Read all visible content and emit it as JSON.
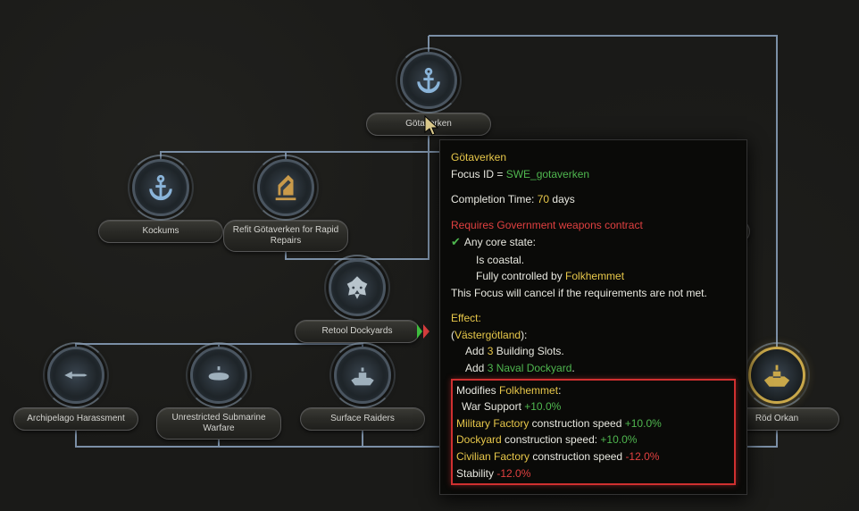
{
  "focus_nodes": {
    "gotaverken": {
      "label": "Götaverken"
    },
    "kockums": {
      "label": "Kockums"
    },
    "refit": {
      "label": "Refit Götaverken for Rapid Repairs"
    },
    "retool": {
      "label": "Retool Dockyards"
    },
    "archipelago": {
      "label": "Archipelago Harassment"
    },
    "submarine": {
      "label": "Unrestricted Submarine Warfare"
    },
    "surface": {
      "label": "Surface Raiders"
    },
    "rod_orkan": {
      "label": "Röd Orkan"
    },
    "hidden_right": {
      "label": "n"
    }
  },
  "tooltip": {
    "title": "Götaverken",
    "focus_id_label": "Focus ID = ",
    "focus_id": "SWE_gotaverken",
    "completion_label": "Completion Time: ",
    "completion_value": "70",
    "completion_suffix": " days",
    "requires": "Requires Government weapons contract",
    "req_line1": "Any core state:",
    "req_line2": "Is coastal.",
    "req_line3_prefix": "Fully controlled by ",
    "req_line3_faction": "Folkhemmet",
    "cancel_text": "This Focus will cancel if the requirements are not met.",
    "effect_label": "Effect:",
    "state_prefix": "(",
    "state_name": "Västergötland",
    "state_suffix": "):",
    "eff1_prefix": "Add ",
    "eff1_value": "3",
    "eff1_suffix": " Building Slots.",
    "eff2_prefix": "Add ",
    "eff2_value": "3 Naval Dockyard",
    "eff2_suffix": ".",
    "mod_label": "Modifies ",
    "mod_target": "Folkhemmet",
    "mod_suffix": ":",
    "ws_label": "War Support ",
    "ws_value": "+10.0%",
    "mf_label": "Military Factory",
    "mf_mid": " construction speed ",
    "mf_value": "+10.0%",
    "dy_label": "Dockyard",
    "dy_mid": " construction speed: ",
    "dy_value": "+10.0%",
    "cf_label": "Civilian Factory",
    "cf_mid": " construction speed ",
    "cf_value": "-12.0%",
    "st_label": "Stability ",
    "st_value": "-12.0%"
  }
}
